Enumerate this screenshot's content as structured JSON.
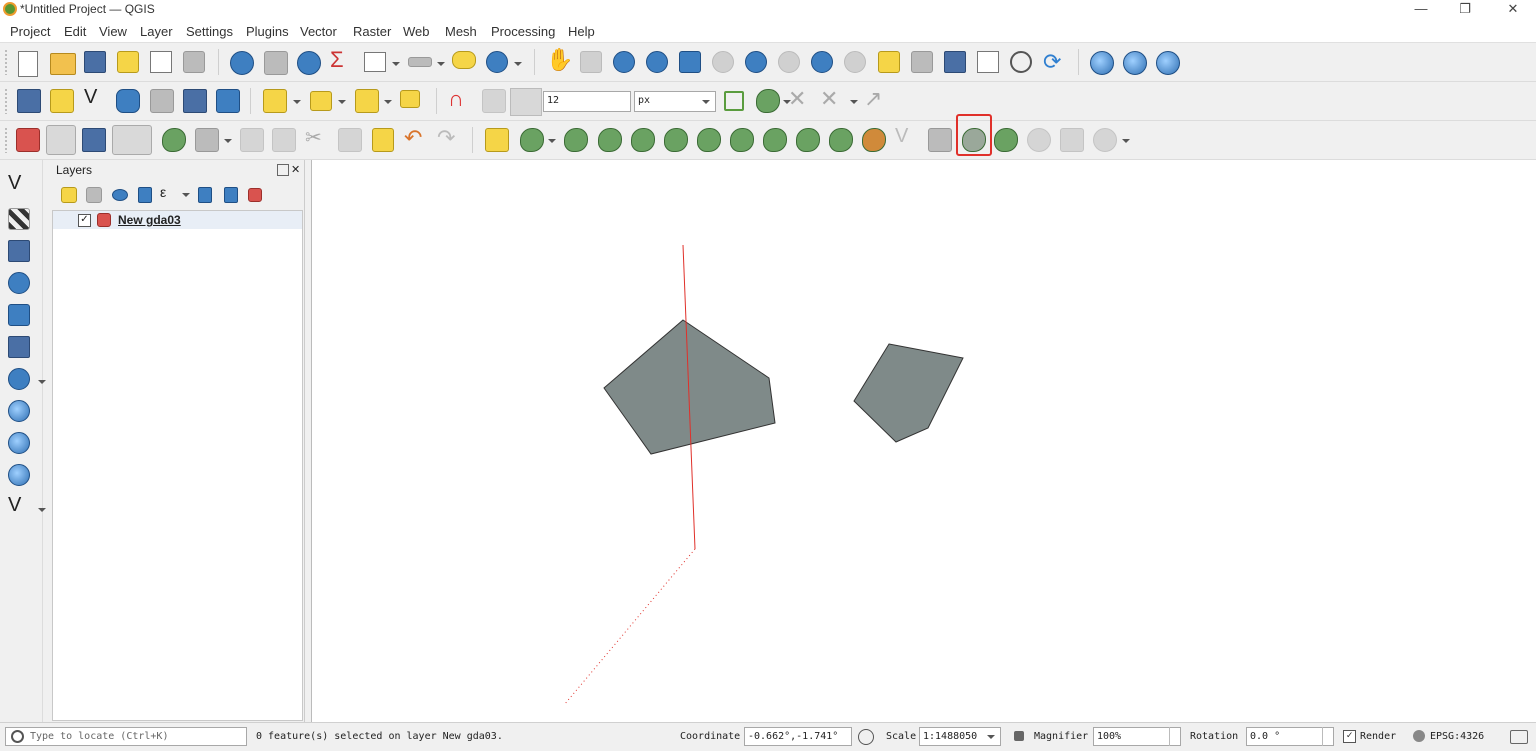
{
  "window": {
    "title": "*Untitled Project — QGIS",
    "minimize": "—",
    "maximize": "❐",
    "close": "✕"
  },
  "menu": [
    "Project",
    "Edit",
    "View",
    "Layer",
    "Settings",
    "Plugins",
    "Vector",
    "Raster",
    "Web",
    "Mesh",
    "Processing",
    "Help"
  ],
  "snapping": {
    "tolerance": "12",
    "unit": "px"
  },
  "layers_panel": {
    "title": "Layers",
    "items": [
      {
        "name": "New gda03",
        "checked": "✓"
      }
    ]
  },
  "statusbar": {
    "locate_placeholder": "Type to locate (Ctrl+K)",
    "message": "0 feature(s) selected on layer New gda03.",
    "coordinate_label": "Coordinate",
    "coordinate_value": "-0.662°,-1.741°",
    "scale_label": "Scale",
    "scale_value": "1:1488050",
    "magnifier_label": "Magnifier",
    "magnifier_value": "100%",
    "rotation_label": "Rotation",
    "rotation_value": "0.0 °",
    "render_label": "Render",
    "render_checked": "✓",
    "crs": "EPSG:4326"
  },
  "icons": {
    "search": "search-icon",
    "lock": "lock-icon",
    "split_features": "split-features-icon"
  }
}
